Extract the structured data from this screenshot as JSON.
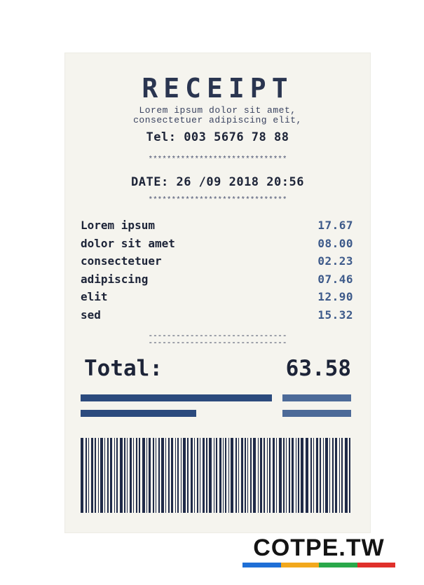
{
  "receipt": {
    "title": "RECEIPT",
    "subtitle_line1": "Lorem ipsum dolor sit amet,",
    "subtitle_line2": "consectetuer adipiscing elit,",
    "tel": "Tel: 003 5676 78 88",
    "stars": "******************************",
    "date": "DATE: 26 /09 2018 20:56",
    "items": [
      {
        "name": "Lorem ipsum",
        "price": "17.67"
      },
      {
        "name": "dolor sit amet",
        "price": "08.00"
      },
      {
        "name": "consectetuer",
        "price": "02.23"
      },
      {
        "name": "adipiscing",
        "price": "07.46"
      },
      {
        "name": "elit",
        "price": "12.90"
      },
      {
        "name": "sed",
        "price": "15.32"
      }
    ],
    "dashes": "------------------------------",
    "total_label": "Total:",
    "total_value": "63.58"
  },
  "brand": {
    "name": "COTPE.TW",
    "colors": [
      "#1f6fd6",
      "#f2a81d",
      "#2aa84a",
      "#e0302b"
    ]
  },
  "colors": {
    "paper": "#f5f4ee",
    "ink": "#1d2438",
    "accent_dark": "#2b4a7d",
    "accent_light": "#4c6a98"
  }
}
